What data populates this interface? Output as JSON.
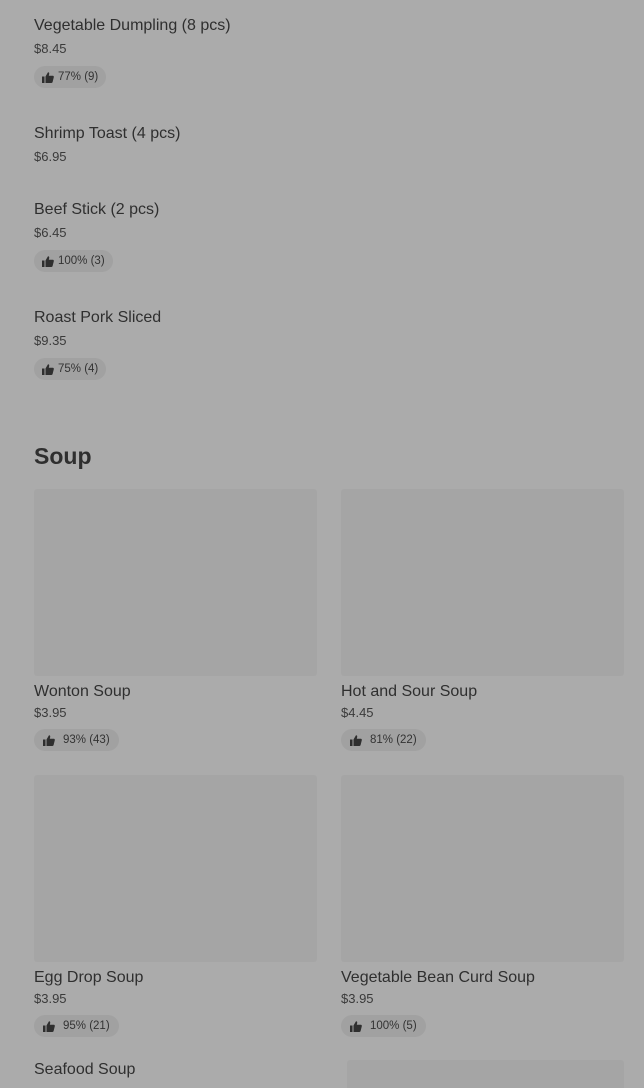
{
  "top_items": [
    {
      "name": "Vegetable Dumpling (8 pcs)",
      "price": "$8.45",
      "rating": "77% (9)"
    },
    {
      "name": "Shrimp Toast (4 pcs)",
      "price": "$6.95",
      "rating": null
    },
    {
      "name": "Beef Stick (2 pcs)",
      "price": "$6.45",
      "rating": "100% (3)"
    },
    {
      "name": "Roast Pork Sliced",
      "price": "$9.35",
      "rating": "75% (4)"
    }
  ],
  "soup_section": {
    "title": "Soup",
    "cards": [
      {
        "name": "Wonton Soup",
        "price": "$3.95",
        "rating": "93% (43)"
      },
      {
        "name": "Hot and Sour Soup",
        "price": "$4.45",
        "rating": "81% (22)"
      },
      {
        "name": "Egg Drop Soup",
        "price": "$3.95",
        "rating": "95% (21)"
      },
      {
        "name": "Vegetable Bean Curd Soup",
        "price": "$3.95",
        "rating": "100% (5)"
      }
    ],
    "partial_item": {
      "name": "Seafood Soup"
    }
  },
  "icons": {
    "rating": "thumbs-up-icon"
  }
}
